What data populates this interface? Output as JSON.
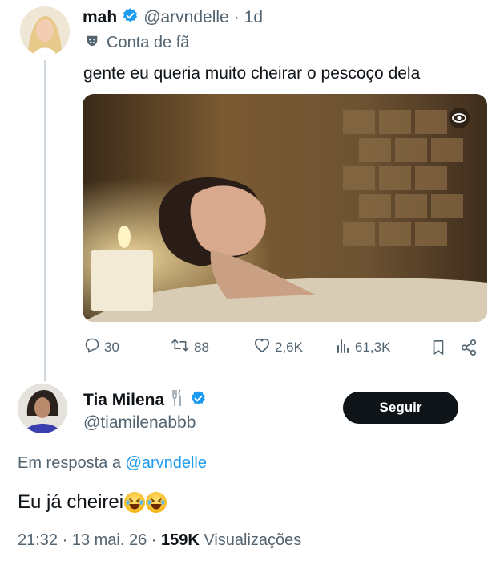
{
  "tweet": {
    "author_name": "mah",
    "author_handle": "@arvndelle",
    "time_sep": "·",
    "time": "1d",
    "badge_label": "Conta de fã",
    "text": "gente eu queria muito cheirar o pescoço dela",
    "actions": {
      "replies": "30",
      "retweets": "88",
      "likes": "2,6K",
      "views": "61,3K"
    }
  },
  "reply": {
    "author_name": "Tia Milena",
    "author_handle": "@tiamilenabbb",
    "follow_label": "Seguir",
    "in_reply_prefix": "Em resposta a",
    "in_reply_handle": "@arvndelle",
    "text": "Eu já cheirei",
    "emoji_count": 2,
    "timestamp": "21:32 · 13 mai. 26 ·",
    "views_count": "159K",
    "views_label": "Visualizações"
  },
  "colors": {
    "verified": "#1d9bf0",
    "muted": "#536471",
    "link": "#1d9bf0",
    "button_bg": "#0f1419"
  }
}
